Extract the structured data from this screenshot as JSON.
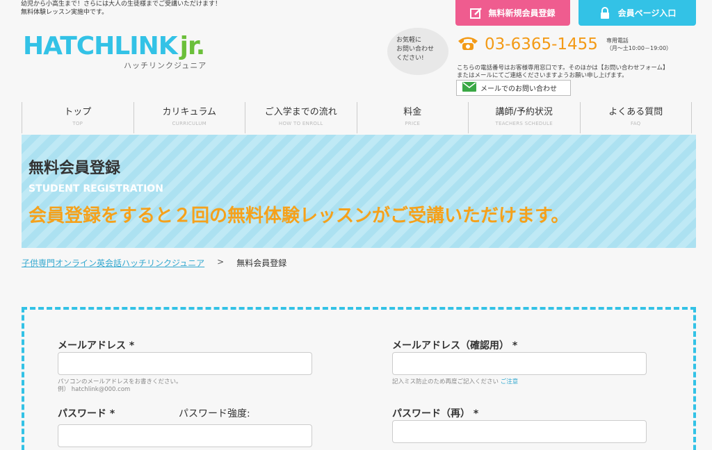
{
  "header": {
    "tagline_line1": "幼児から小高生まで！さらには大人の生徒様までご受講いただけます！",
    "tagline_line2": "無料体験レッスン実施中です。",
    "register_button": "無料新規会員登録",
    "member_button": "会員ページ入口",
    "logo_main": "HATCHLINK",
    "logo_jr": "jr.",
    "logo_sub": "ハッチリンクジュニア",
    "bubble_line1": "お気軽に",
    "bubble_line2": "お問い合わせ",
    "bubble_line3": "ください!",
    "phone_number": "03-6365-1455",
    "phone_hours_line1": "専用電話",
    "phone_hours_line2": "（月～土10:00－19:00）",
    "phone_note_line1": "こちらの電話番号はお客様専用窓口です。そのほかは【お問い合わせフォーム】",
    "phone_note_line2": "またはメールにてご連絡くださいますようお願い申し上げます。",
    "mail_button": "メールでのお問い合わせ"
  },
  "nav": [
    {
      "jp": "トップ",
      "en": "TOP"
    },
    {
      "jp": "カリキュラム",
      "en": "CURRICULUM"
    },
    {
      "jp": "ご入学までの流れ",
      "en": "HOW TO ENROLL"
    },
    {
      "jp": "料金",
      "en": "PRICE"
    },
    {
      "jp": "講師/予約状況",
      "en": "TEACHERS SCHEDULE"
    },
    {
      "jp": "よくある質問",
      "en": "FAQ"
    }
  ],
  "hero": {
    "title": "無料会員登録",
    "subtitle": "STUDENT REGISTRATION",
    "lead": "会員登録をすると２回の無料体験レッスンがご受講いただけます。"
  },
  "breadcrumb": {
    "home": "子供専門オンライン英会話ハッチリンクジュニア",
    "sep": ">",
    "current": "無料会員登録"
  },
  "form": {
    "email_label": "メールアドレス *",
    "email_hint1": "パソコンのメールアドレスをお書きください。",
    "email_hint2": "例） hatchlink@000.com",
    "email_confirm_label": "メールアドレス（確認用） *",
    "email_confirm_hint": "記入ミス防止のため再度ご記入ください",
    "email_confirm_hint_link": "ご注意",
    "password_label": "パスワード *",
    "password_strength_label": "パスワード強度:",
    "password_confirm_label": "パスワード（再） *"
  },
  "colors": {
    "accent_blue": "#33c2e6",
    "accent_pink": "#ef5c8f",
    "accent_orange": "#f5a11b",
    "accent_green": "#6bbf3a"
  }
}
